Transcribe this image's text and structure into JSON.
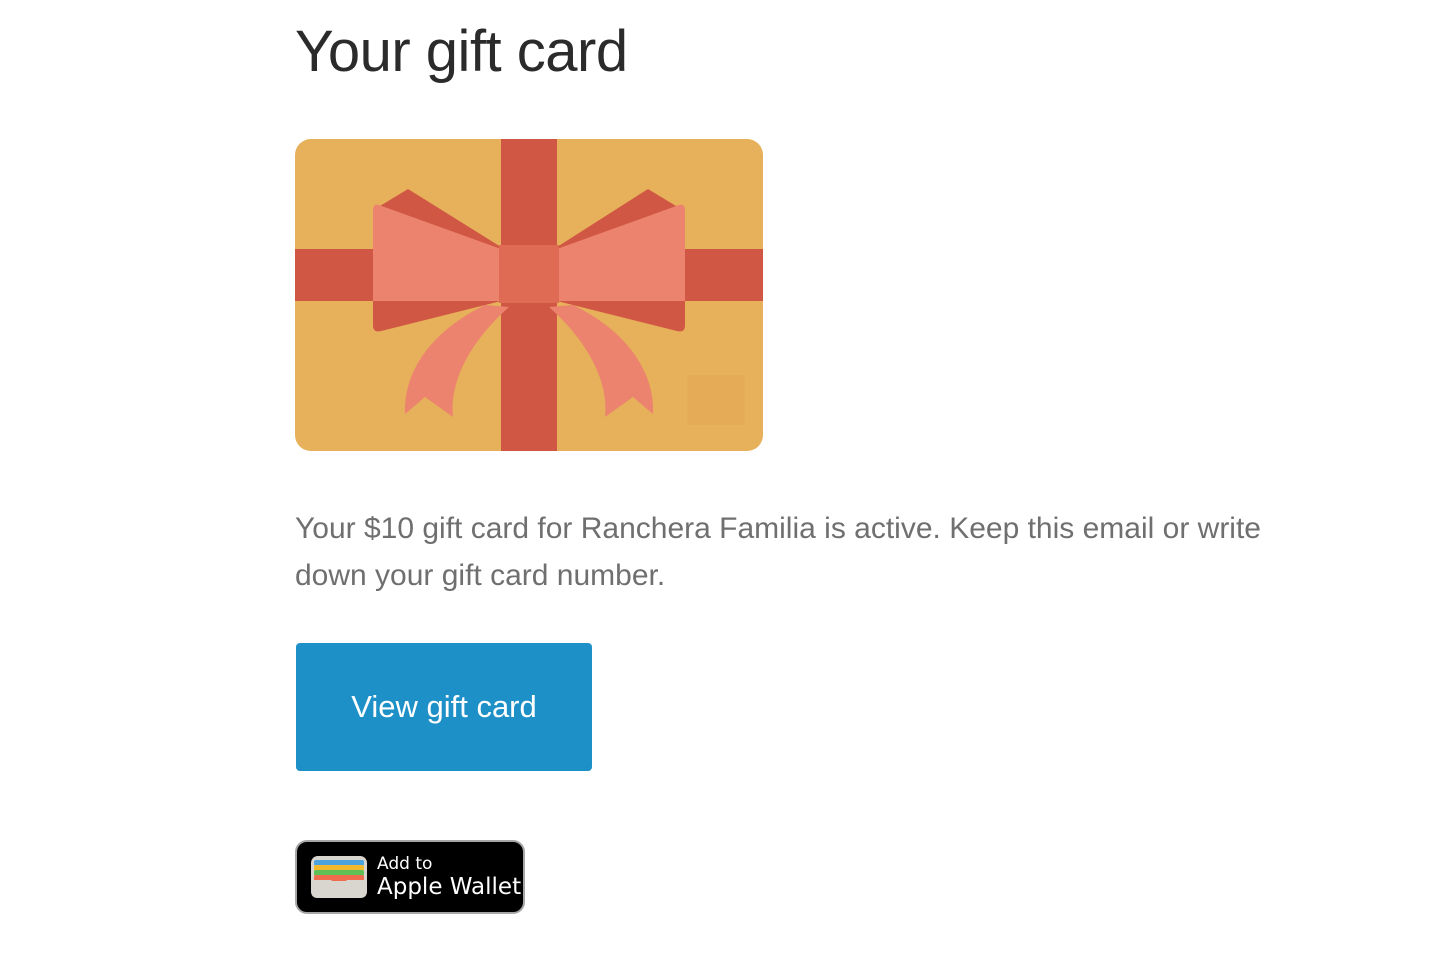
{
  "header": {
    "title": "Your gift card"
  },
  "gift_card_image": {
    "icon": "gift-card-bow-icon",
    "colors": {
      "card": "#e7b05a",
      "ribbon": "#d05743",
      "bow": "#ec836e",
      "knot": "#e06b55"
    }
  },
  "body": {
    "message": "Your $10 gift card for Ranchera Familia is active. Keep this email or write down your gift card number."
  },
  "actions": {
    "view_label": "View gift card",
    "view_color": "#1d90c7",
    "wallet_line1": "Add to",
    "wallet_line2": "Apple Wallet",
    "wallet_icon": "apple-wallet-icon"
  }
}
